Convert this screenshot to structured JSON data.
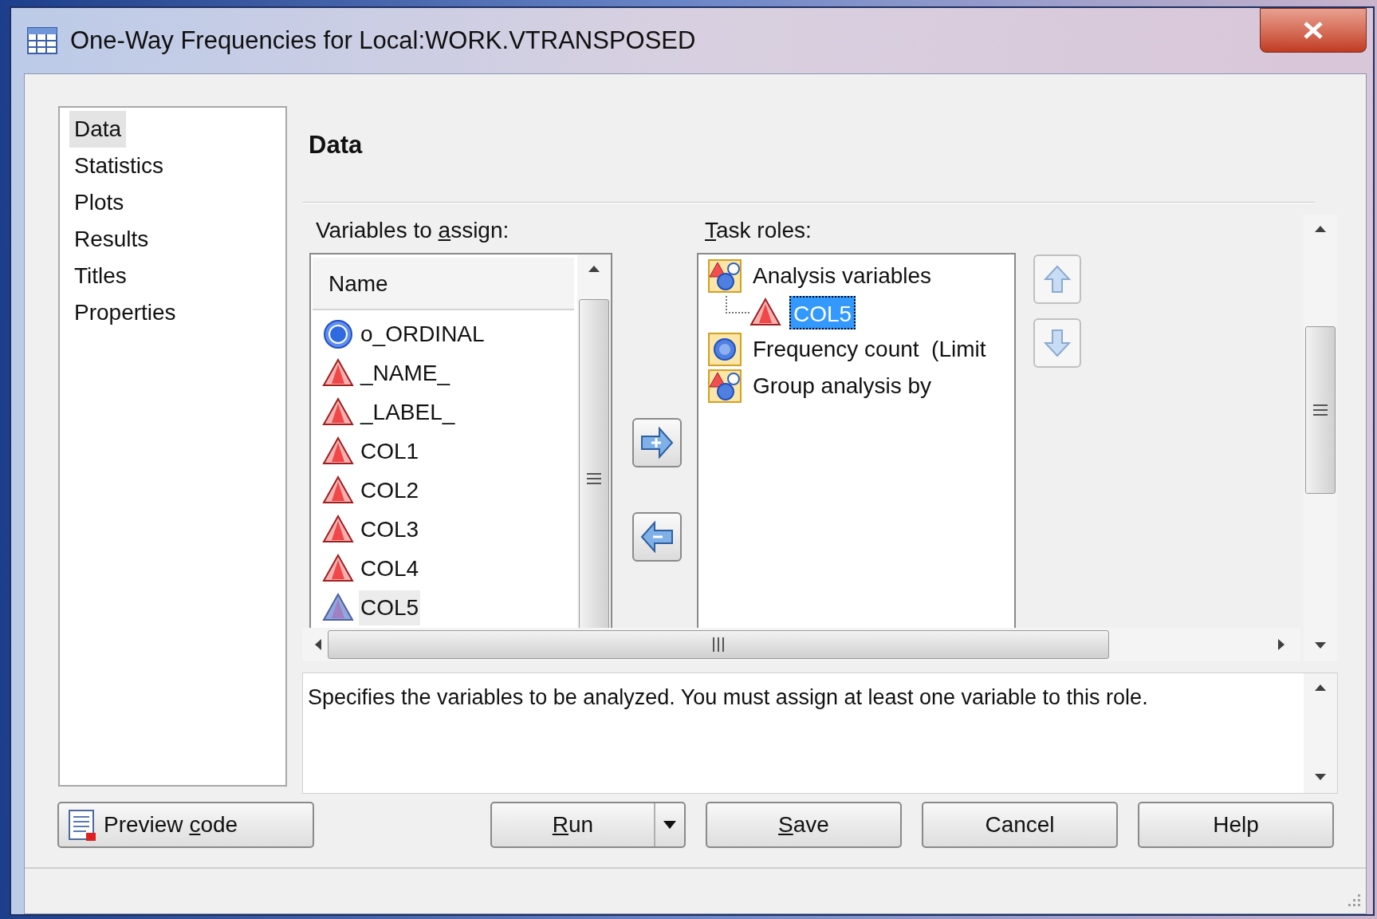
{
  "window": {
    "title": "One-Way Frequencies for Local:WORK.VTRANSPOSED"
  },
  "nav": [
    {
      "label": "Data",
      "selected": true
    },
    {
      "label": "Statistics",
      "selected": false
    },
    {
      "label": "Plots",
      "selected": false
    },
    {
      "label": "Results",
      "selected": false
    },
    {
      "label": "Titles",
      "selected": false
    },
    {
      "label": "Properties",
      "selected": false
    }
  ],
  "page_title": "Data",
  "variables": {
    "label": {
      "text": "Variables to ",
      "key": "a",
      "rest": "ssign:"
    },
    "column": "Name",
    "items": [
      {
        "name": "o_ORDINAL",
        "kind": "numeric",
        "selected": false
      },
      {
        "name": "_NAME_",
        "kind": "character",
        "selected": false
      },
      {
        "name": "_LABEL_",
        "kind": "character",
        "selected": false
      },
      {
        "name": "COL1",
        "kind": "character",
        "selected": false
      },
      {
        "name": "COL2",
        "kind": "character",
        "selected": false
      },
      {
        "name": "COL3",
        "kind": "character",
        "selected": false
      },
      {
        "name": "COL4",
        "kind": "character",
        "selected": false
      },
      {
        "name": "COL5",
        "kind": "character",
        "selected": true
      }
    ]
  },
  "task_roles": {
    "label": {
      "key": "T",
      "rest": "ask roles:"
    },
    "roles": [
      {
        "name": "Analysis variables",
        "kind": "multi",
        "children": [
          {
            "name": "COL5",
            "selected": true
          }
        ]
      },
      {
        "name": "Frequency count  (Limit",
        "kind": "single"
      },
      {
        "name": "Group analysis by",
        "kind": "multi"
      }
    ]
  },
  "description": "Specifies the variables to be analyzed. You must assign at least one variable to this role.",
  "buttons": [
    {
      "label": {
        "text": "Preview ",
        "key": "c",
        "rest": "ode"
      },
      "kind": "preview"
    },
    {
      "label": {
        "key": "R",
        "rest": "un"
      },
      "kind": "split"
    },
    {
      "label": {
        "key": "S",
        "rest": "ave"
      },
      "kind": "plain"
    },
    {
      "label": {
        "text": "Cancel"
      },
      "kind": "plain"
    },
    {
      "label": {
        "text": "Help"
      },
      "kind": "plain"
    }
  ]
}
